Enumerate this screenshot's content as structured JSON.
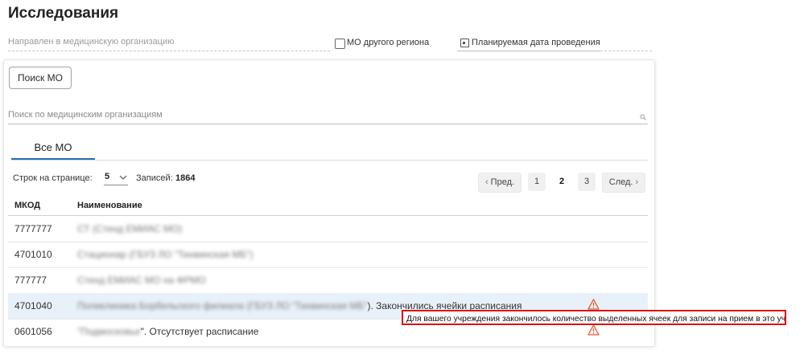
{
  "page": {
    "title": "Исследования"
  },
  "filters": {
    "directed_to_mo_placeholder": "Направлен в медицинскую организацию",
    "other_region_label": "МО другого региона",
    "planned_date_label": "Планируемая дата проведения"
  },
  "panel": {
    "search_mo_button": "Поиск МО",
    "search_placeholder": "Поиск по медицинским организациям",
    "tabs": [
      {
        "label": "Все МО",
        "active": true
      }
    ]
  },
  "pagination": {
    "rows_per_page_label": "Строк на странице:",
    "rows_per_page_value": "5",
    "records_label": "Записей:",
    "records_count": "1864",
    "prev_label": "Пред.",
    "next_label": "След.",
    "pages": [
      "1",
      "2",
      "3"
    ],
    "current_page": "2"
  },
  "table": {
    "columns": [
      "МКОД",
      "Наименование"
    ],
    "rows": [
      {
        "code": "7777777",
        "name_redacted": "СТ (Стенд ЕМИАС МО)",
        "suffix": ""
      },
      {
        "code": "4701010",
        "name_redacted": "Стационар (ГБУЗ ЛО \"Тихвинская МБ\")",
        "suffix": ""
      },
      {
        "code": "777777",
        "name_redacted": "Стенд ЕМИАС МО на ФРМО",
        "suffix": ""
      },
      {
        "code": "4701040",
        "name_redacted": "Поликлиника Борбельского филиала (ГБУЗ ЛО \"Тихвинская МБ\"",
        "suffix": "). Закончились ячейки расписания",
        "warning": true,
        "highlighted": true
      },
      {
        "code": "0601056",
        "name_redacted": "\"Подмосковье",
        "suffix": "\". Отсутствует расписание",
        "warning": true
      }
    ]
  },
  "tooltip": {
    "text": "Для вашего учреждения закончилось количество выделенных ячеек для записи на прием в это учреждение"
  },
  "colors": {
    "accent": "#2a6fb0",
    "warning": "#e25a2b",
    "tooltip_border": "#e01010",
    "row_highlight": "#e8f1f9"
  },
  "icons": {
    "calendar": "calendar-icon",
    "search": "search-icon",
    "dropdown": "chevron-down-icon",
    "warning": "warning-icon"
  }
}
